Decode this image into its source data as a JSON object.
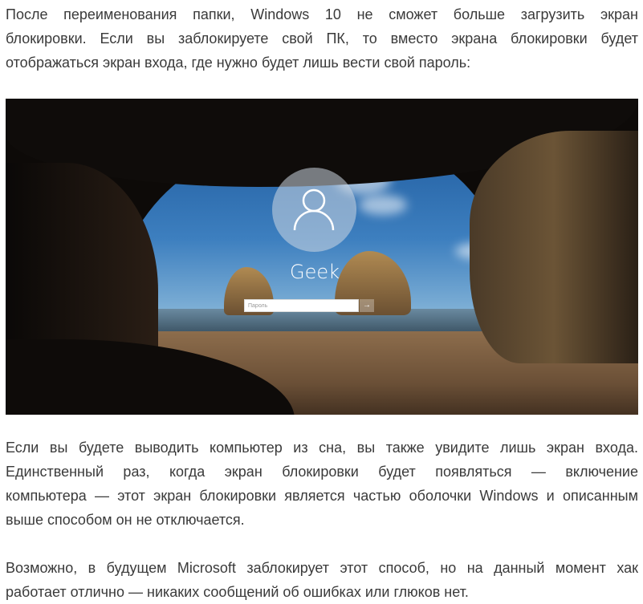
{
  "paragraphs": [
    {
      "lines": [
        "После переименования папки, Windows 10 не сможет больше загрузить экран",
        "блокировки. Если вы заблокируете свой ПК, то вместо экрана блокировки будет",
        "отображаться экран входа, где нужно будет лишь вести свой пароль:"
      ]
    },
    {
      "lines": [
        "Если вы будете выводить компьютер из сна, вы также увидите лишь экран входа.",
        "Единственный раз, когда экран блокировки будет появляться — включение",
        "компьютера — этот экран блокировки является частью оболочки Windows и описанным",
        "выше способом он не отключается."
      ]
    },
    {
      "lines": [
        "Возможно, в будущем Microsoft заблокирует этот способ, но на данный момент хак",
        "работает отлично — никаких сообщений об ошибках или глюков нет."
      ]
    }
  ],
  "screenshot": {
    "username": "Geek",
    "password_placeholder": "Пароль",
    "submit_icon": "arrow-right-icon",
    "avatar_icon": "user-icon"
  }
}
